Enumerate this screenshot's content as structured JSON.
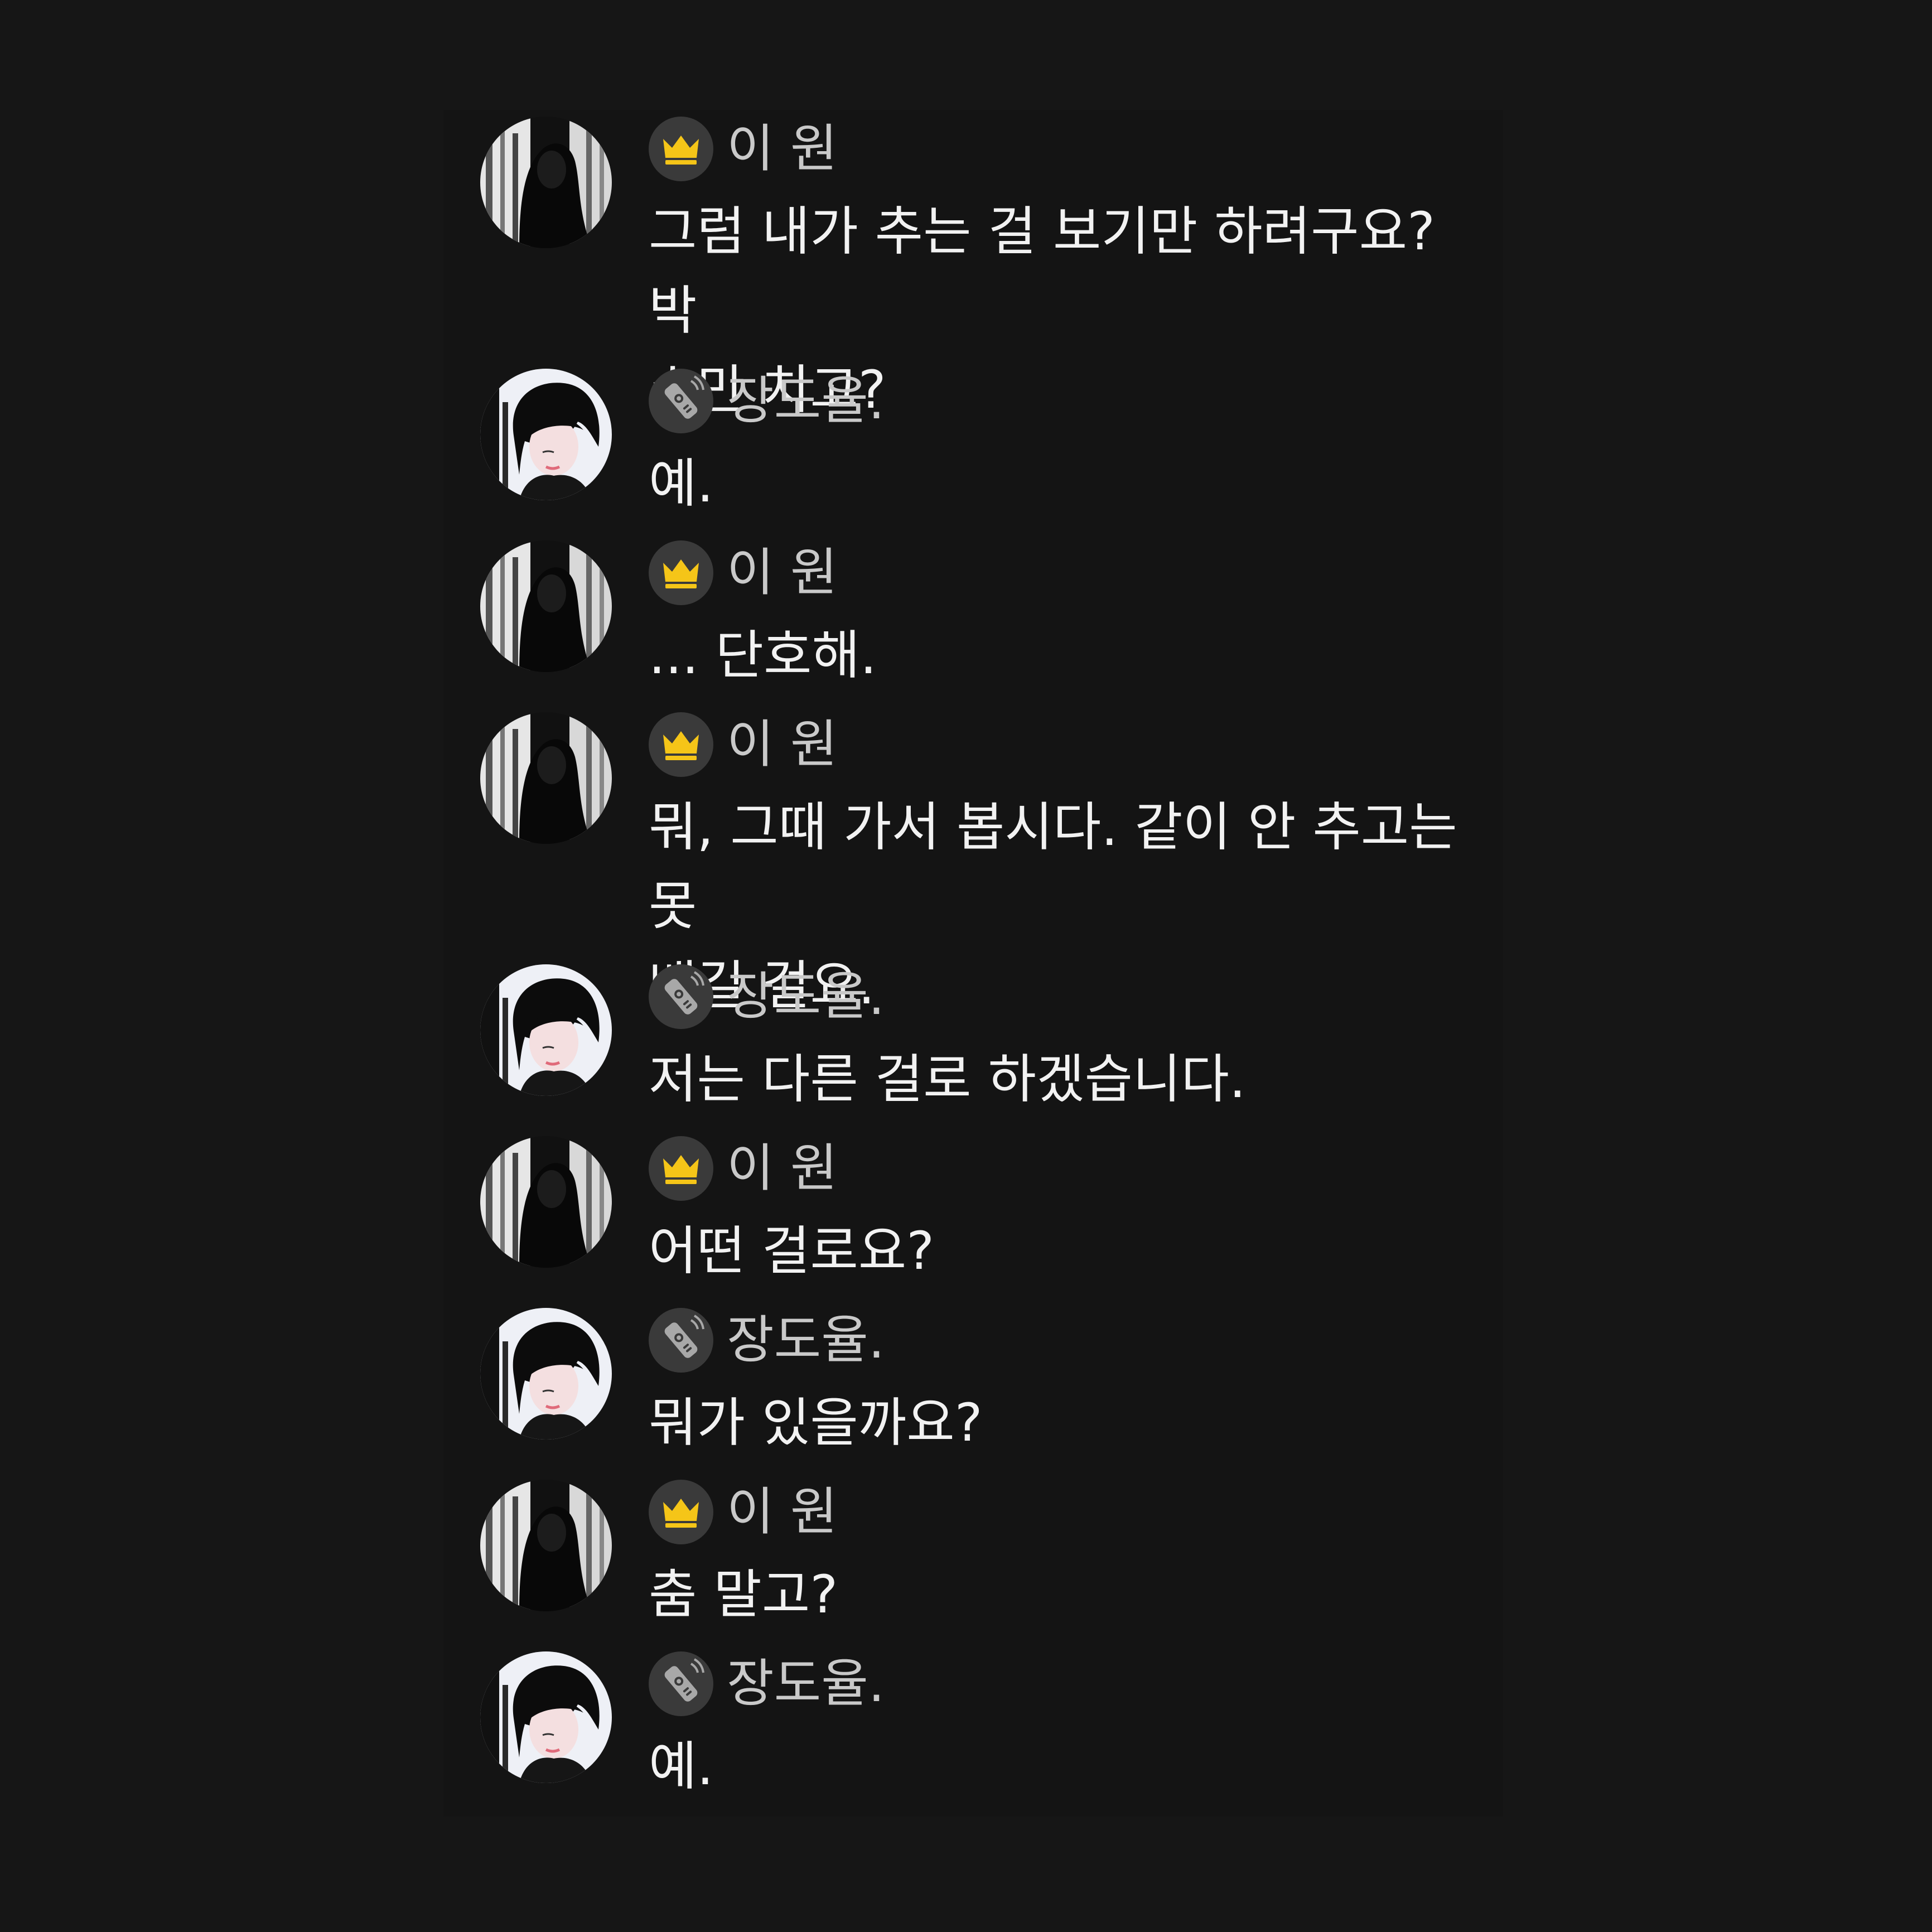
{
  "users": {
    "iwon": {
      "name": "이 원",
      "badge_icon": "crown-icon",
      "badge_color": "#f5c518",
      "avatar": "avatar-iwon"
    },
    "jang": {
      "name": "장도율.",
      "badge_icon": "remote-control-icon",
      "badge_color": "#9a9a9a",
      "avatar": "avatar-jangdoyul"
    }
  },
  "messages": [
    {
      "user": "iwon",
      "name": "이 원",
      "text": "그럼 내가 추는 걸 보기만 하려구요? 박\n수만 치고?"
    },
    {
      "user": "jang",
      "name": "장도율.",
      "text": "예."
    },
    {
      "user": "iwon",
      "name": "이 원",
      "text": "... 단호해."
    },
    {
      "user": "iwon",
      "name": "이 원",
      "text": "뭐, 그때 가서 봅시다. 같이 안 추고는 못\n배길 걸요."
    },
    {
      "user": "jang",
      "name": "장도율.",
      "text": "저는 다른 걸로 하겠습니다."
    },
    {
      "user": "iwon",
      "name": "이 원",
      "text": "어떤 걸로요?"
    },
    {
      "user": "jang",
      "name": "장도율.",
      "text": "뭐가 있을까요?"
    },
    {
      "user": "iwon",
      "name": "이 원",
      "text": "춤 말고?"
    },
    {
      "user": "jang",
      "name": "장도율.",
      "text": "예."
    }
  ]
}
